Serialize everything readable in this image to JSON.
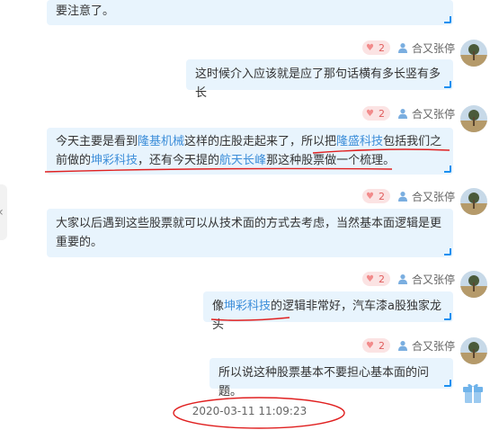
{
  "user_name": "合又张停",
  "colors": {
    "bubble": "#e8f4fd",
    "link": "#3d8ed9",
    "underline": "#e02020",
    "like_bg": "#fbe3e3"
  },
  "messages": [
    {
      "like_count": "2",
      "segments": [
        {
          "t": "这时候介入应该就是应了那句话横有多长竖有多长"
        }
      ]
    },
    {
      "like_count": "2",
      "segments": [
        {
          "t": "今天主要是看到"
        },
        {
          "t": "隆基机械",
          "link": true
        },
        {
          "t": "这样的庄股走起来了，所以把"
        },
        {
          "t": "隆盛科技",
          "link": true
        },
        {
          "t": "包括我们之前做的"
        },
        {
          "t": "坤彩科技",
          "link": true
        },
        {
          "t": "，还有今天提的"
        },
        {
          "t": "航天长峰",
          "link": true
        },
        {
          "t": "那这种股票做一个梳理。"
        }
      ]
    },
    {
      "like_count": "2",
      "segments": [
        {
          "t": "大家以后遇到这些股票就可以从技术面的方式去考虑，当然基本面逻辑是更重要的。"
        }
      ]
    },
    {
      "like_count": "2",
      "segments": [
        {
          "t": "像"
        },
        {
          "t": "坤彩科技",
          "link": true
        },
        {
          "t": "的逻辑非常好，汽车漆a股独家龙头"
        }
      ]
    },
    {
      "like_count": "2",
      "segments": [
        {
          "t": "所以说这种股票基本不要担心基本面的问题。"
        }
      ]
    }
  ],
  "top_fragment": "要注意了。",
  "timestamp": "2020-03-11 11:09:23",
  "icons": {
    "like": "heart-icon",
    "user": "user-icon",
    "avatar": "avatar-landscape",
    "collapse": "chevron-left-icon",
    "float": "gift-icon"
  }
}
